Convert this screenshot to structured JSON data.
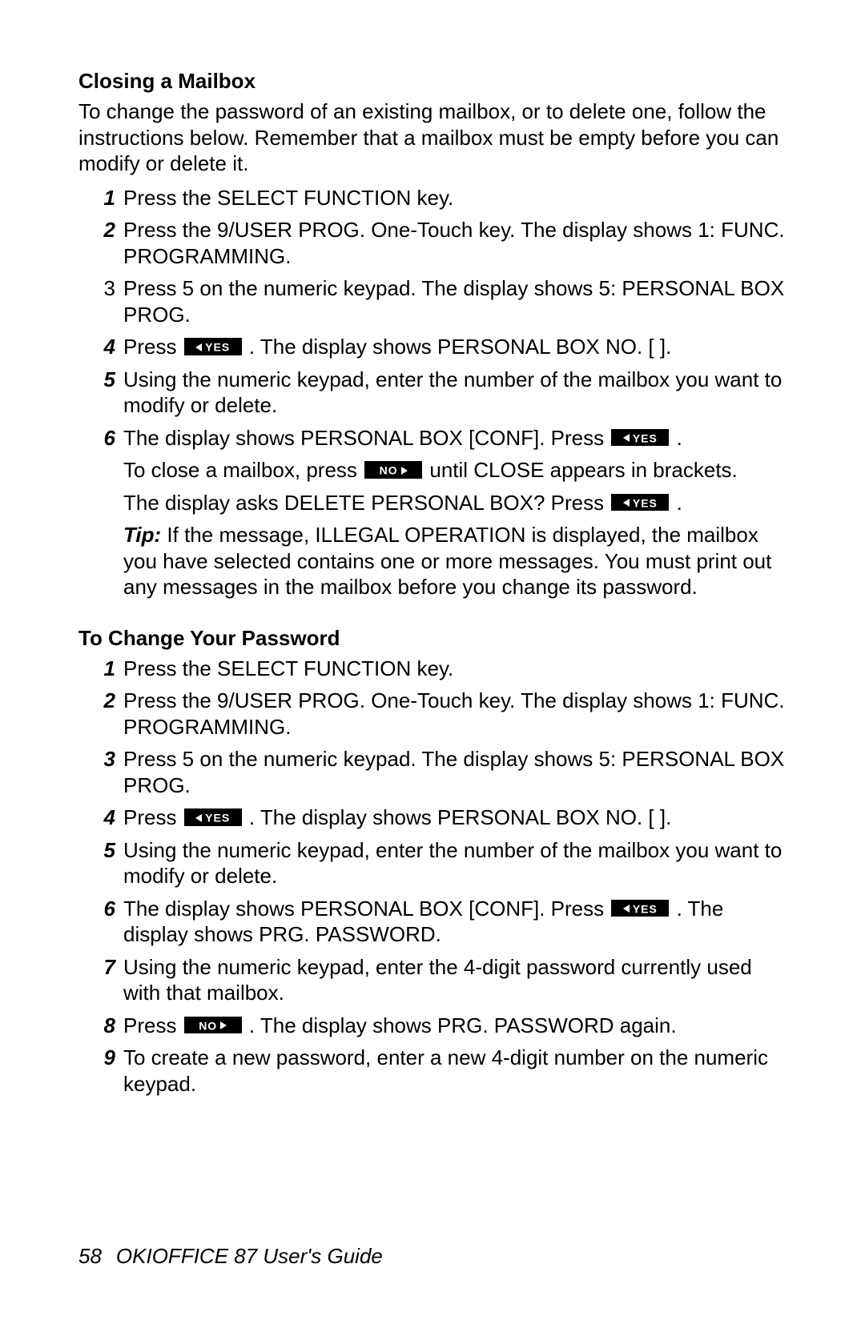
{
  "buttons": {
    "yes": "YES",
    "no": "NO"
  },
  "section1": {
    "heading": "Closing a Mailbox",
    "intro": "To change the password of an existing mailbox, or to delete one, follow the instructions below.  Remember that a mailbox must be empty before you can modify or delete it.",
    "steps": [
      "Press the SELECT FUNCTION key.",
      "Press the 9/USER PROG. One-Touch key. The display shows 1: FUNC. PROGRAMMING.",
      "Press 5 on the numeric keypad.  The display shows 5: PERSONAL BOX PROG.",
      {
        "pre": "Press ",
        "btn": "yes",
        "post": " .  The display shows PERSONAL BOX NO. [  ]."
      },
      "Using the numeric keypad, enter the number of the mailbox you want to modify or delete.",
      {
        "pre": "The display shows PERSONAL BOX [CONF].  Press ",
        "btn": "yes",
        "post": " ."
      }
    ],
    "cont1": {
      "pre": "To close a mailbox, press ",
      "btn": "no",
      "post": " until CLOSE appears in brackets."
    },
    "cont2": {
      "pre": "The display asks DELETE PERSONAL BOX?  Press ",
      "btn": "yes",
      "post": " ."
    },
    "tipLabel": "Tip:",
    "tipBody": " If the message, ILLEGAL OPERATION is displayed, the mailbox you have selected contains one or more messages.  You must print out any messages in the mailbox before you change its password."
  },
  "section2": {
    "heading": "To Change Your Password",
    "steps": [
      "Press the SELECT FUNCTION key.",
      "Press the 9/USER PROG. One-Touch key. The display shows 1: FUNC. PROGRAMMING.",
      "Press 5 on the numeric keypad.  The display shows 5: PERSONAL BOX PROG.",
      {
        "pre": "Press ",
        "btn": "yes",
        "post": " . The display shows PERSONAL BOX NO. [  ]."
      },
      "Using the numeric keypad, enter the number of the mailbox you want to modify or delete.",
      {
        "pre": "The display shows PERSONAL BOX [CONF].  Press ",
        "btn": "yes",
        "post": " . The display shows PRG. PASSWORD."
      },
      "Using the numeric keypad, enter the 4-digit password currently used with that mailbox.",
      {
        "pre": "Press ",
        "btn": "no",
        "post": " .  The display shows PRG. PASSWORD again."
      },
      "To create a new password, enter a new 4-digit number on the numeric keypad."
    ]
  },
  "footer": {
    "page": "58",
    "title": "OKIOFFICE 87 User's Guide"
  },
  "plainNumIndex": 3
}
